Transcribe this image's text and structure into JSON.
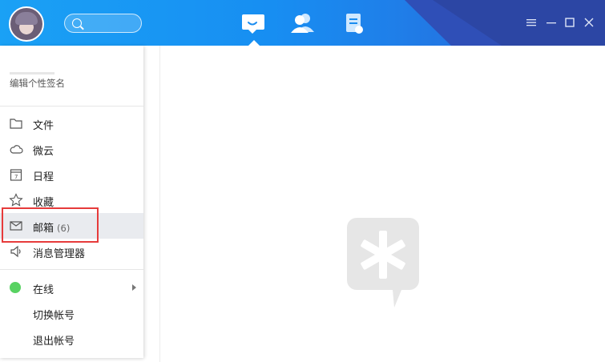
{
  "header": {
    "search": {
      "placeholder": ""
    },
    "tabs": [
      {
        "name": "messages",
        "icon": "chat-bubble-icon",
        "selected": true
      },
      {
        "name": "contacts",
        "icon": "contacts-icon",
        "selected": false
      },
      {
        "name": "space",
        "icon": "notes-icon",
        "selected": false
      }
    ],
    "window_controls": [
      "menu-icon",
      "minimize-icon",
      "maximize-icon",
      "close-icon"
    ]
  },
  "profile_panel": {
    "signature": "编辑个性签名",
    "menu": [
      {
        "label": "文件",
        "icon": "folder-icon"
      },
      {
        "label": "微云",
        "icon": "cloud-icon"
      },
      {
        "label": "日程",
        "icon": "calendar-icon"
      },
      {
        "label": "收藏",
        "icon": "star-icon"
      },
      {
        "label": "邮箱",
        "count": "(6)",
        "icon": "mail-icon"
      },
      {
        "label": "消息管理器",
        "icon": "speaker-icon"
      }
    ],
    "status": {
      "label": "在线",
      "color": "#58d262"
    },
    "account": [
      {
        "label": "切换帐号"
      },
      {
        "label": "退出帐号"
      }
    ]
  },
  "colors": {
    "header_start": "#1aa1f5",
    "header_end": "#2b5cd0",
    "highlight": "#e63b3b"
  }
}
